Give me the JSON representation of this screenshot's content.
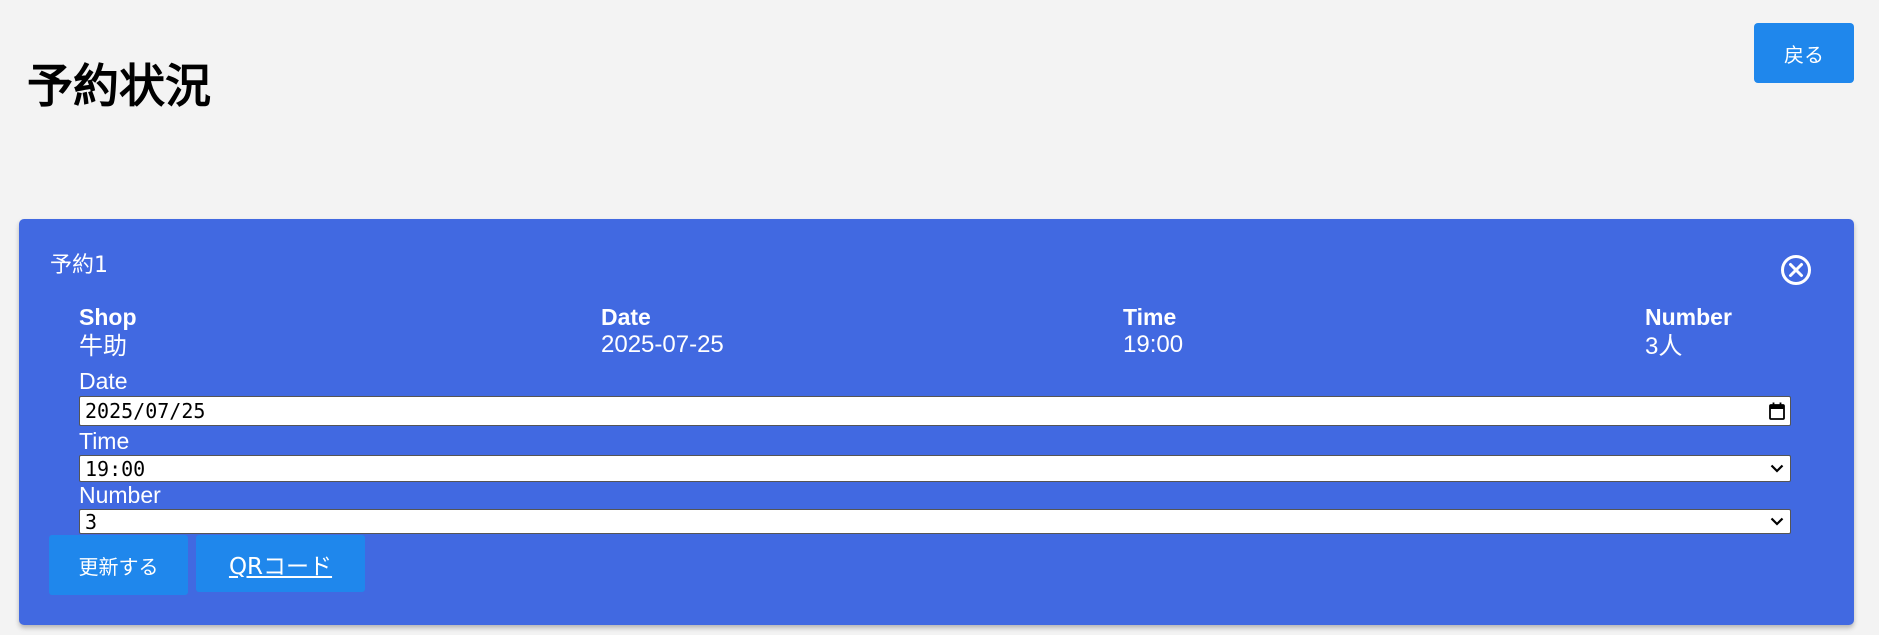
{
  "page": {
    "title": "予約状況",
    "back_label": "戻る"
  },
  "reservation": {
    "title": "予約1",
    "summary": {
      "shop_header": "Shop",
      "shop_value": "牛助",
      "date_header": "Date",
      "date_value": "2025-07-25",
      "time_header": "Time",
      "time_value": "19:00",
      "number_header": "Number",
      "number_value": "3人"
    },
    "form": {
      "date_label": "Date",
      "date_value": "2025/07/25",
      "time_label": "Time",
      "time_value": "19:00",
      "number_label": "Number",
      "number_value": "3"
    },
    "update_label": "更新する",
    "qr_label": "QRコード"
  },
  "colors": {
    "background": "#f3f3f3",
    "card": "#4169e1",
    "button": "#1f87ec"
  },
  "icons": {
    "close": "close-circle-icon",
    "calendar": "calendar-icon",
    "dropdown": "chevron-down-icon"
  }
}
